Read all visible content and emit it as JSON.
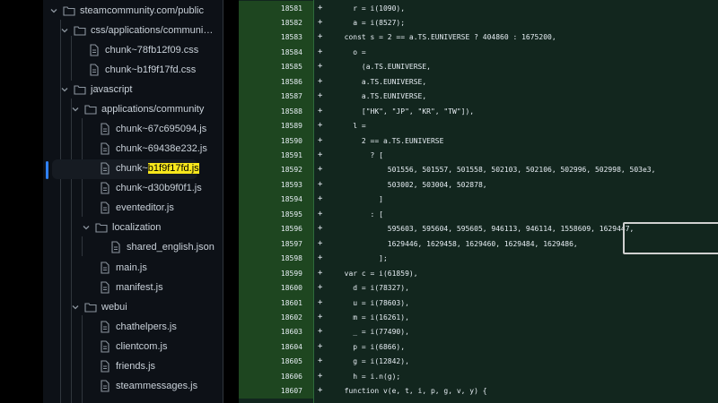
{
  "sidebar": {
    "items": [
      {
        "label": "steamcommunity.com/public",
        "type": "folder",
        "open": true
      },
      {
        "label": "css/applications/communi…",
        "type": "folder",
        "open": true
      },
      {
        "label": "chunk~78fb12f09.css",
        "type": "file"
      },
      {
        "label": "chunk~b1f9f17fd.css",
        "type": "file"
      },
      {
        "label": "javascript",
        "type": "folder",
        "open": true
      },
      {
        "label": "applications/community",
        "type": "folder",
        "open": true
      },
      {
        "label": "chunk~67c695094.js",
        "type": "file"
      },
      {
        "label": "chunk~69438e232.js",
        "type": "file"
      },
      {
        "label_prefix": "chunk~",
        "label_highlight": "b1f9f17fd.js",
        "type": "file",
        "active": true
      },
      {
        "label": "chunk~d30b9f0f1.js",
        "type": "file"
      },
      {
        "label": "eventeditor.js",
        "type": "file"
      },
      {
        "label": "localization",
        "type": "folder",
        "open": true
      },
      {
        "label": "shared_english.json",
        "type": "file"
      },
      {
        "label": "main.js",
        "type": "file"
      },
      {
        "label": "manifest.js",
        "type": "file"
      },
      {
        "label": "webui",
        "type": "folder",
        "open": true
      },
      {
        "label": "chathelpers.js",
        "type": "file"
      },
      {
        "label": "clientcom.js",
        "type": "file"
      },
      {
        "label": "friends.js",
        "type": "file"
      },
      {
        "label": "steammessages.js",
        "type": "file"
      }
    ]
  },
  "diff": {
    "lines": [
      {
        "num": "18581",
        "code": "    r = i(1090),"
      },
      {
        "num": "18582",
        "code": "    a = i(8527);"
      },
      {
        "num": "18583",
        "code": "  const s = 2 == a.TS.EUNIVERSE ? 404860 : 1675200,"
      },
      {
        "num": "18584",
        "code": "    o ="
      },
      {
        "num": "18585",
        "code": "      (a.TS.EUNIVERSE,"
      },
      {
        "num": "18586",
        "code": "      a.TS.EUNIVERSE,"
      },
      {
        "num": "18587",
        "code": "      a.TS.EUNIVERSE,"
      },
      {
        "num": "18588",
        "code": "      [\"HK\", \"JP\", \"KR\", \"TW\"]),"
      },
      {
        "num": "18589",
        "code": "    l ="
      },
      {
        "num": "18590",
        "code": "      2 == a.TS.EUNIVERSE"
      },
      {
        "num": "18591",
        "code": "        ? ["
      },
      {
        "num": "18592",
        "code": "            501556, 501557, 501558, 502103, 502106, 502996, 502998, 503e3,"
      },
      {
        "num": "18593",
        "code": "            503002, 503004, 502878,"
      },
      {
        "num": "18594",
        "code": "          ]"
      },
      {
        "num": "18595",
        "code": "        : ["
      },
      {
        "num": "18596",
        "code": "            595603, 595604, 595605, 946113, 946114, 1558609, 1629447,"
      },
      {
        "num": "18597",
        "code": "            1629446, 1629458, 1629460, 1629484, 1629486,"
      },
      {
        "num": "18598",
        "code": "          ];"
      },
      {
        "num": "18599",
        "code": "  var c = i(61859),"
      },
      {
        "num": "18600",
        "code": "    d = i(78327),"
      },
      {
        "num": "18601",
        "code": "    u = i(78603),"
      },
      {
        "num": "18602",
        "code": "    m = i(16261),"
      },
      {
        "num": "18603",
        "code": "    _ = i(77490),"
      },
      {
        "num": "18604",
        "code": "    p = i(6866),"
      },
      {
        "num": "18605",
        "code": "    g = i(12842),"
      },
      {
        "num": "18606",
        "code": "    h = i.n(g);"
      },
      {
        "num": "18607",
        "code": "  function v(e, t, i, p, g, v, y) {"
      }
    ],
    "plus": "+"
  },
  "colors": {
    "highlight": "#f8e71c",
    "gutter": "#1e4620",
    "diff_bg": "#12261e"
  }
}
